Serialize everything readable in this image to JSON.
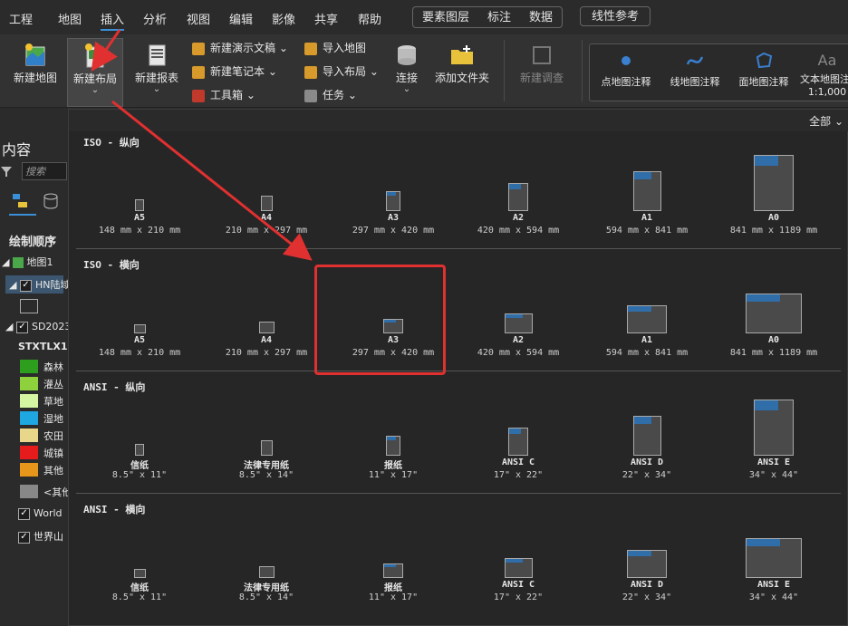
{
  "menubar": {
    "items": [
      "工程",
      "地图",
      "插入",
      "分析",
      "视图",
      "编辑",
      "影像",
      "共享",
      "帮助"
    ],
    "context_tabs": [
      "要素图层",
      "标注",
      "数据"
    ],
    "extra_tab": "线性参考"
  },
  "ribbon": {
    "new_map": "新建地图",
    "new_layout": "新建布局",
    "new_report": "新建报表",
    "new_presentation": "新建演示文稿",
    "new_notebook": "新建笔记本",
    "toolbox": "工具箱",
    "import_map": "导入地图",
    "import_layout": "导入布局",
    "task": "任务",
    "connect": "连接",
    "add_folder": "添加文件夹",
    "new_survey": "新建调查",
    "point_annotation": "点地图注释",
    "line_annotation": "线地图注释",
    "area_annotation": "面地图注释",
    "text_annotation": "文本地图注释",
    "text_scale": "1:1,000"
  },
  "left_panel": {
    "title": "内容",
    "search_placeholder": "搜索",
    "draw_order": "绘制顺序",
    "map1": "地图1",
    "layer_hn": "HN陆域",
    "layer_sd": "SD2023",
    "field": "STXTLX1",
    "legend": [
      {
        "label": "森林",
        "color": "#2e9e1f"
      },
      {
        "label": "灌丛",
        "color": "#8fd13c"
      },
      {
        "label": "草地",
        "color": "#d6f5a3"
      },
      {
        "label": "湿地",
        "color": "#1ea7e0"
      },
      {
        "label": "农田",
        "color": "#e8d68a"
      },
      {
        "label": "城镇",
        "color": "#e61b1b"
      },
      {
        "label": "其他",
        "color": "#e6961a"
      },
      {
        "label": "<其他",
        "color": "#888888"
      }
    ],
    "world": "World",
    "world_mountain": "世界山"
  },
  "gallery": {
    "filter": "全部",
    "sections": [
      {
        "title": "ISO - 纵向",
        "orientation": "portrait",
        "items": [
          {
            "name": "A5",
            "size": "148 mm x 210 mm"
          },
          {
            "name": "A4",
            "size": "210 mm x 297 mm"
          },
          {
            "name": "A3",
            "size": "297 mm x 420 mm"
          },
          {
            "name": "A2",
            "size": "420 mm x 594 mm"
          },
          {
            "name": "A1",
            "size": "594 mm x 841 mm"
          },
          {
            "name": "A0",
            "size": "841 mm x 1189 mm"
          }
        ]
      },
      {
        "title": "ISO - 横向",
        "orientation": "landscape",
        "items": [
          {
            "name": "A5",
            "size": "148 mm x 210 mm"
          },
          {
            "name": "A4",
            "size": "210 mm x 297 mm"
          },
          {
            "name": "A3",
            "size": "297 mm x 420 mm"
          },
          {
            "name": "A2",
            "size": "420 mm x 594 mm"
          },
          {
            "name": "A1",
            "size": "594 mm x 841 mm"
          },
          {
            "name": "A0",
            "size": "841 mm x 1189 mm"
          }
        ]
      },
      {
        "title": "ANSI - 纵向",
        "orientation": "portrait",
        "items": [
          {
            "name": "信纸",
            "size": "8.5\" x 11\""
          },
          {
            "name": "法律专用纸",
            "size": "8.5\" x 14\""
          },
          {
            "name": "报纸",
            "size": "11\" x 17\""
          },
          {
            "name": "ANSI C",
            "size": "17\" x 22\""
          },
          {
            "name": "ANSI D",
            "size": "22\" x 34\""
          },
          {
            "name": "ANSI E",
            "size": "34\" x 44\""
          }
        ]
      },
      {
        "title": "ANSI - 横向",
        "orientation": "landscape",
        "items": [
          {
            "name": "信纸",
            "size": "8.5\" x 11\""
          },
          {
            "name": "法律专用纸",
            "size": "8.5\" x 14\""
          },
          {
            "name": "报纸",
            "size": "11\" x 17\""
          },
          {
            "name": "ANSI C",
            "size": "17\" x 22\""
          },
          {
            "name": "ANSI D",
            "size": "22\" x 34\""
          },
          {
            "name": "ANSI E",
            "size": "34\" x 44\""
          }
        ]
      }
    ]
  },
  "colors": {
    "annotation": "#e03030",
    "accent": "#3a8fd6",
    "page_header": "#2f6ea8"
  }
}
